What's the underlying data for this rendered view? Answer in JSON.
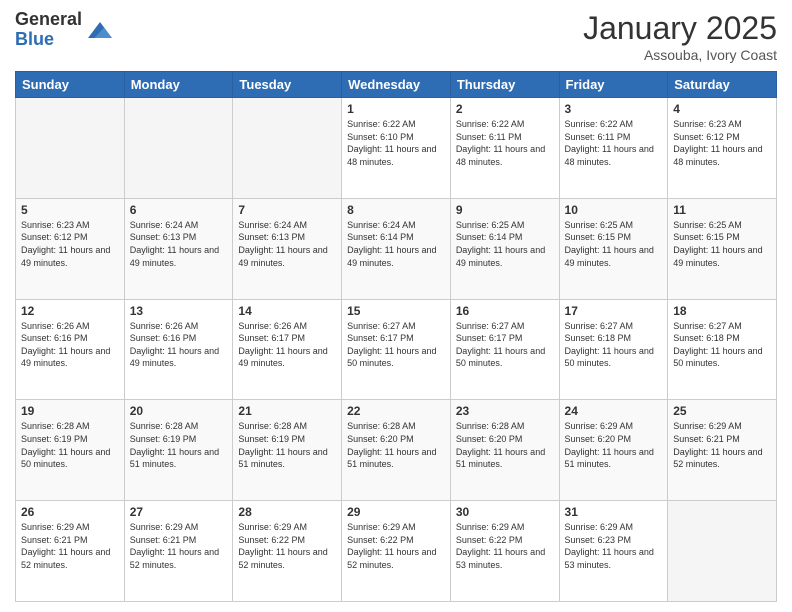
{
  "logo": {
    "general": "General",
    "blue": "Blue"
  },
  "header": {
    "month": "January 2025",
    "location": "Assouba, Ivory Coast"
  },
  "weekdays": [
    "Sunday",
    "Monday",
    "Tuesday",
    "Wednesday",
    "Thursday",
    "Friday",
    "Saturday"
  ],
  "weeks": [
    [
      {
        "day": "",
        "info": ""
      },
      {
        "day": "",
        "info": ""
      },
      {
        "day": "",
        "info": ""
      },
      {
        "day": "1",
        "info": "Sunrise: 6:22 AM\nSunset: 6:10 PM\nDaylight: 11 hours and 48 minutes."
      },
      {
        "day": "2",
        "info": "Sunrise: 6:22 AM\nSunset: 6:11 PM\nDaylight: 11 hours and 48 minutes."
      },
      {
        "day": "3",
        "info": "Sunrise: 6:22 AM\nSunset: 6:11 PM\nDaylight: 11 hours and 48 minutes."
      },
      {
        "day": "4",
        "info": "Sunrise: 6:23 AM\nSunset: 6:12 PM\nDaylight: 11 hours and 48 minutes."
      }
    ],
    [
      {
        "day": "5",
        "info": "Sunrise: 6:23 AM\nSunset: 6:12 PM\nDaylight: 11 hours and 49 minutes."
      },
      {
        "day": "6",
        "info": "Sunrise: 6:24 AM\nSunset: 6:13 PM\nDaylight: 11 hours and 49 minutes."
      },
      {
        "day": "7",
        "info": "Sunrise: 6:24 AM\nSunset: 6:13 PM\nDaylight: 11 hours and 49 minutes."
      },
      {
        "day": "8",
        "info": "Sunrise: 6:24 AM\nSunset: 6:14 PM\nDaylight: 11 hours and 49 minutes."
      },
      {
        "day": "9",
        "info": "Sunrise: 6:25 AM\nSunset: 6:14 PM\nDaylight: 11 hours and 49 minutes."
      },
      {
        "day": "10",
        "info": "Sunrise: 6:25 AM\nSunset: 6:15 PM\nDaylight: 11 hours and 49 minutes."
      },
      {
        "day": "11",
        "info": "Sunrise: 6:25 AM\nSunset: 6:15 PM\nDaylight: 11 hours and 49 minutes."
      }
    ],
    [
      {
        "day": "12",
        "info": "Sunrise: 6:26 AM\nSunset: 6:16 PM\nDaylight: 11 hours and 49 minutes."
      },
      {
        "day": "13",
        "info": "Sunrise: 6:26 AM\nSunset: 6:16 PM\nDaylight: 11 hours and 49 minutes."
      },
      {
        "day": "14",
        "info": "Sunrise: 6:26 AM\nSunset: 6:17 PM\nDaylight: 11 hours and 49 minutes."
      },
      {
        "day": "15",
        "info": "Sunrise: 6:27 AM\nSunset: 6:17 PM\nDaylight: 11 hours and 50 minutes."
      },
      {
        "day": "16",
        "info": "Sunrise: 6:27 AM\nSunset: 6:17 PM\nDaylight: 11 hours and 50 minutes."
      },
      {
        "day": "17",
        "info": "Sunrise: 6:27 AM\nSunset: 6:18 PM\nDaylight: 11 hours and 50 minutes."
      },
      {
        "day": "18",
        "info": "Sunrise: 6:27 AM\nSunset: 6:18 PM\nDaylight: 11 hours and 50 minutes."
      }
    ],
    [
      {
        "day": "19",
        "info": "Sunrise: 6:28 AM\nSunset: 6:19 PM\nDaylight: 11 hours and 50 minutes."
      },
      {
        "day": "20",
        "info": "Sunrise: 6:28 AM\nSunset: 6:19 PM\nDaylight: 11 hours and 51 minutes."
      },
      {
        "day": "21",
        "info": "Sunrise: 6:28 AM\nSunset: 6:19 PM\nDaylight: 11 hours and 51 minutes."
      },
      {
        "day": "22",
        "info": "Sunrise: 6:28 AM\nSunset: 6:20 PM\nDaylight: 11 hours and 51 minutes."
      },
      {
        "day": "23",
        "info": "Sunrise: 6:28 AM\nSunset: 6:20 PM\nDaylight: 11 hours and 51 minutes."
      },
      {
        "day": "24",
        "info": "Sunrise: 6:29 AM\nSunset: 6:20 PM\nDaylight: 11 hours and 51 minutes."
      },
      {
        "day": "25",
        "info": "Sunrise: 6:29 AM\nSunset: 6:21 PM\nDaylight: 11 hours and 52 minutes."
      }
    ],
    [
      {
        "day": "26",
        "info": "Sunrise: 6:29 AM\nSunset: 6:21 PM\nDaylight: 11 hours and 52 minutes."
      },
      {
        "day": "27",
        "info": "Sunrise: 6:29 AM\nSunset: 6:21 PM\nDaylight: 11 hours and 52 minutes."
      },
      {
        "day": "28",
        "info": "Sunrise: 6:29 AM\nSunset: 6:22 PM\nDaylight: 11 hours and 52 minutes."
      },
      {
        "day": "29",
        "info": "Sunrise: 6:29 AM\nSunset: 6:22 PM\nDaylight: 11 hours and 52 minutes."
      },
      {
        "day": "30",
        "info": "Sunrise: 6:29 AM\nSunset: 6:22 PM\nDaylight: 11 hours and 53 minutes."
      },
      {
        "day": "31",
        "info": "Sunrise: 6:29 AM\nSunset: 6:23 PM\nDaylight: 11 hours and 53 minutes."
      },
      {
        "day": "",
        "info": ""
      }
    ]
  ]
}
